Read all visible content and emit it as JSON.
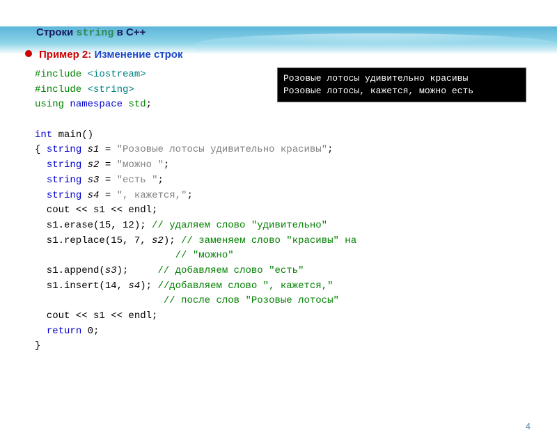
{
  "header": {
    "title_prefix": "Строки ",
    "title_code": "string",
    "title_suffix": " в С++"
  },
  "subtitle": {
    "example_label": "Пример 2: ",
    "example_desc": "Изменение строк"
  },
  "code": {
    "l1a": "#include ",
    "l1b": "<iostream>",
    "l2a": "#include ",
    "l2b": "<string>",
    "l3a": "using",
    "l3b": " namespace ",
    "l3c": "std",
    "l3d": ";",
    "l4": "",
    "l5a": "int",
    "l5b": " main()",
    "l6a": "{ ",
    "l6b": "string",
    "l6c": " s1 = ",
    "l6d": "\"Розовые лотосы удивительно красивы\"",
    "l6e": ";",
    "l7a": "  ",
    "l7b": "string",
    "l7c": " s2 = ",
    "l7d": "\"можно \"",
    "l7e": ";",
    "l8a": "  ",
    "l8b": "string",
    "l8c": " s3 = ",
    "l8d": "\"есть \"",
    "l8e": ";",
    "l9a": "  ",
    "l9b": "string",
    "l9c": " s4 = ",
    "l9d": "\", кажется,\"",
    "l9e": ";",
    "l10a": "  cout << s1 << endl;",
    "l11a": "  s1.erase(15, 12); ",
    "l11b": "// удаляем слово \"удивительно\"",
    "l12a": "  s1.replace(15, 7, ",
    "l12b": "s2",
    "l12c": "); ",
    "l12d": "// заменяем слово \"красивы\" на",
    "l13a": "                        ",
    "l13b": "// \"можно\"",
    "l14a": "  s1.append(",
    "l14b": "s3",
    "l14c": ");     ",
    "l14d": "// добавляем слово \"есть\"",
    "l15a": "  s1.insert(14, ",
    "l15b": "s4",
    "l15c": "); ",
    "l15d": "//добавляем слово \", кажется,\"",
    "l16a": "                      ",
    "l16b": "// после слов \"Розовые лотосы\"",
    "l17a": "  cout << s1 << endl;",
    "l18a": "  ",
    "l18b": "return",
    "l18c": " 0;",
    "l19": "}"
  },
  "console": {
    "line1": "Розовые лотосы удивительно красивы",
    "line2": "Розовые лотосы, кажется, можно есть"
  },
  "page_number": "4"
}
